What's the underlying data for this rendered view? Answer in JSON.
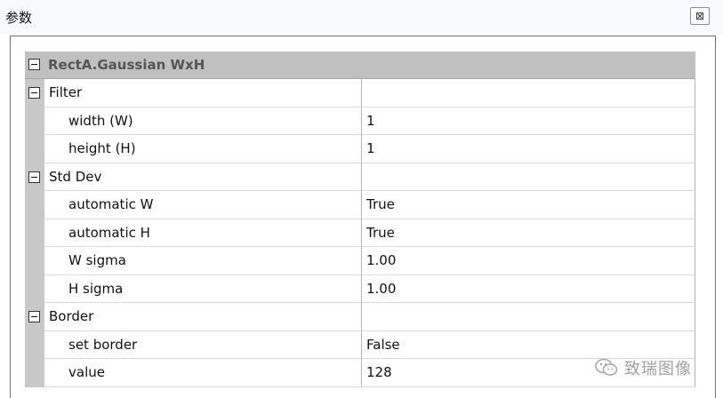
{
  "window": {
    "title": "参数",
    "close_glyph": "⊠"
  },
  "grid": {
    "root_label": "RectA.Gaussian WxH",
    "categories": [
      {
        "label": "Filter",
        "props": [
          {
            "name": "width (W)",
            "value": "1"
          },
          {
            "name": "height (H)",
            "value": "1"
          }
        ]
      },
      {
        "label": "Std Dev",
        "props": [
          {
            "name": "automatic W",
            "value": "True"
          },
          {
            "name": "automatic H",
            "value": "True"
          },
          {
            "name": "W sigma",
            "value": "1.00"
          },
          {
            "name": "H sigma",
            "value": "1.00"
          }
        ]
      },
      {
        "label": "Border",
        "props": [
          {
            "name": "set border",
            "value": "False"
          },
          {
            "name": "value",
            "value": "128"
          }
        ]
      }
    ]
  },
  "watermark": {
    "text": "致瑞图像",
    "icon": "wechat-icon"
  }
}
